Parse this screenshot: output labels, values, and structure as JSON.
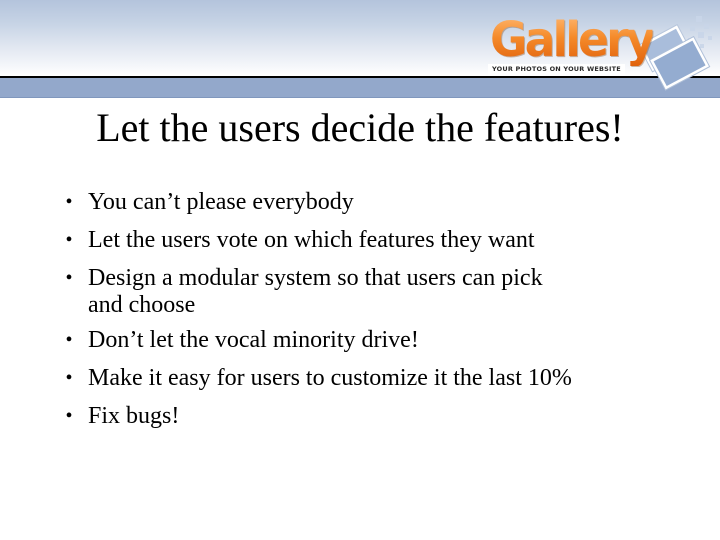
{
  "logo": {
    "wordmark": "Gallery",
    "tagline": "YOUR PHOTOS ON YOUR WEBSITE",
    "icon": "photo-stack-icon",
    "colors": {
      "wordmark_top": "#ffb870",
      "wordmark_bottom": "#e0620c",
      "photo_frame": "#ffffff",
      "photo_fill": "#9fb5d6"
    }
  },
  "header": {
    "colors": {
      "gradient_top": "#b4c4dc",
      "gradient_bottom": "#ffffff",
      "rule": "#000000",
      "band": "#93a8cb"
    }
  },
  "slide": {
    "title": "Let the users decide the features!",
    "bullet_glyph": "•",
    "bullets": [
      {
        "text": "You can’t please everybody"
      },
      {
        "text": "Let the users vote on which features they want"
      },
      {
        "text": "Design a modular system so that users can pick",
        "continuation": "and choose"
      },
      {
        "text": "Don’t let the vocal minority drive!"
      },
      {
        "text": "Make it easy for users to customize it the last 10%"
      },
      {
        "text": "Fix bugs!"
      }
    ]
  }
}
